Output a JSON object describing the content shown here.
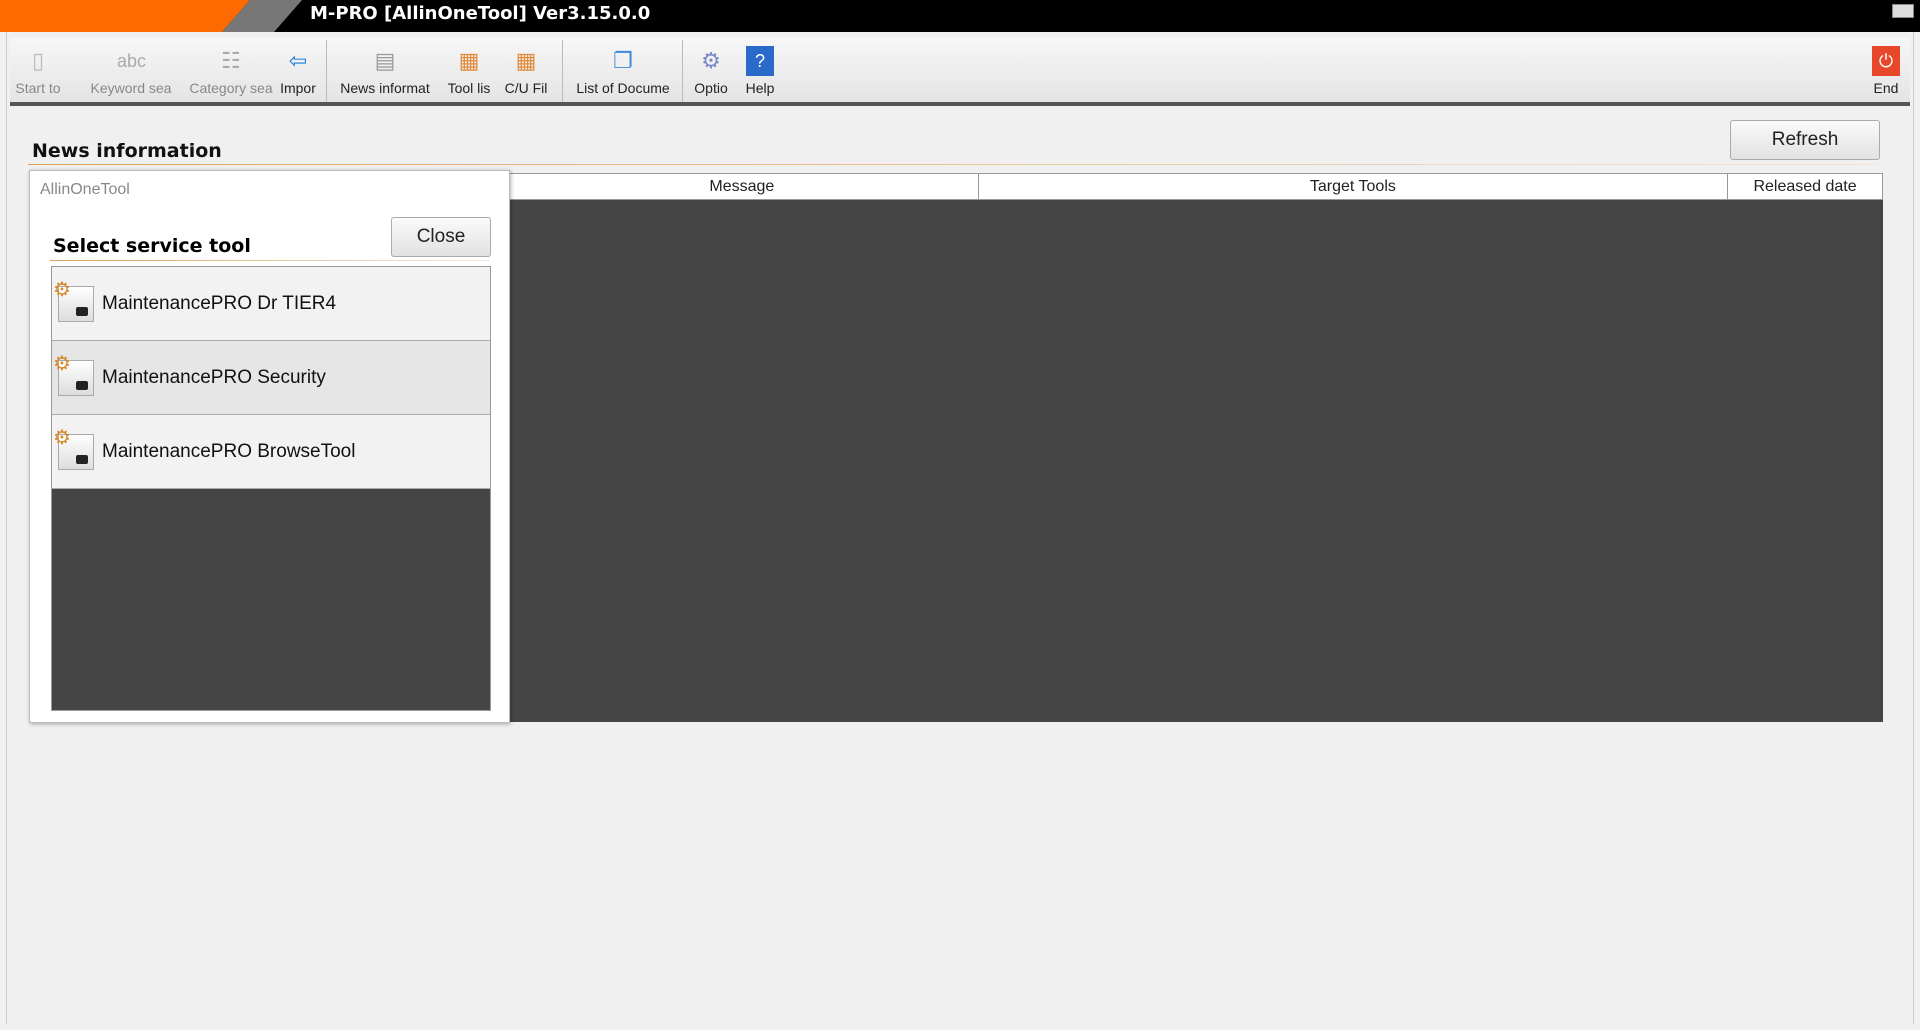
{
  "window": {
    "title": "M-PRO [AllinOneTool] Ver3.15.0.0"
  },
  "toolbar": {
    "items": [
      {
        "label": "Start to",
        "icon": "start-icon",
        "enabled": false
      },
      {
        "label": "Keyword sea",
        "icon": "keyword-search-icon",
        "enabled": false
      },
      {
        "label": "Category sea",
        "icon": "category-search-icon",
        "enabled": false
      },
      {
        "label": "Impor",
        "icon": "import-icon",
        "enabled": true
      },
      {
        "label": "News informat",
        "icon": "news-icon",
        "enabled": true
      },
      {
        "label": "Tool lis",
        "icon": "tool-list-icon",
        "enabled": true
      },
      {
        "label": "C/U Fil",
        "icon": "cu-file-icon",
        "enabled": true
      },
      {
        "label": "List of Docume",
        "icon": "document-list-icon",
        "enabled": true
      },
      {
        "label": "Optio",
        "icon": "options-icon",
        "enabled": true
      },
      {
        "label": "Help",
        "icon": "help-icon",
        "enabled": true
      },
      {
        "label": "End",
        "icon": "power-icon",
        "enabled": true
      }
    ]
  },
  "news": {
    "title": "News information",
    "refresh_label": "Refresh",
    "columns": [
      "Message",
      "Target Tools",
      "Released date"
    ]
  },
  "popup": {
    "title": "AllinOneTool",
    "heading": "Select service tool",
    "close_label": "Close",
    "items": [
      "MaintenancePRO Dr TIER4",
      "MaintenancePRO Security",
      "MaintenancePRO BrowseTool"
    ],
    "selected_index": 1
  },
  "colors": {
    "accent": "#ff6a00",
    "end_button": "#e8482a",
    "grid_bg": "#454545"
  }
}
